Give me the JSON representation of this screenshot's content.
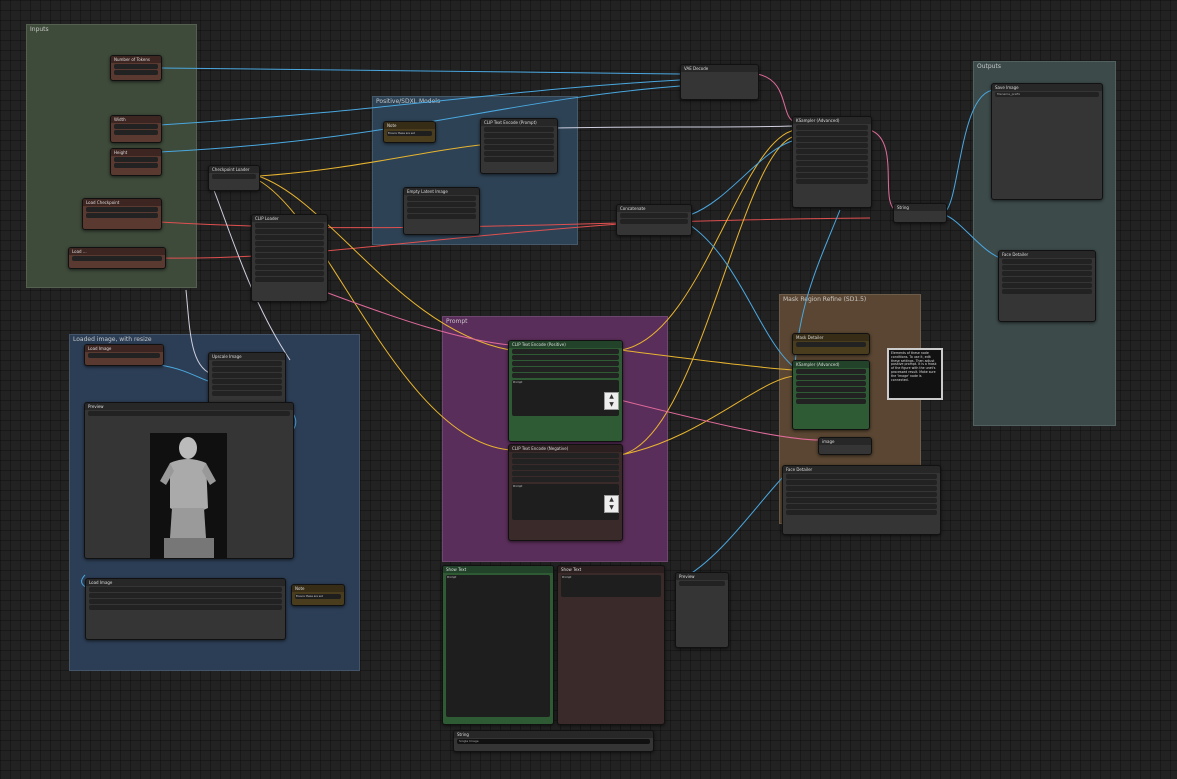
{
  "groups": {
    "inputs": "Inputs",
    "outputs": "Outputs",
    "sdxl_core": "Positive/SDXL Models",
    "prompt": "Prompt",
    "image": "Loaded image, with resize",
    "mask_refiner": "Mask Region Refine (SD1.5)"
  },
  "nodes": {
    "seed": "Number of Tokens",
    "width": "Width",
    "height": "Height",
    "search_prompt": "Load Checkpoint",
    "load_ckpt": "Load ...",
    "checkpoint_loader": "Checkpoint Loader",
    "clip": "CLIP Loader",
    "empty_latent": "Empty Latent Image",
    "note1": "Note",
    "note1_text": "Ensure these are set",
    "clip_encoder": "CLIP Text Encode (Prompt)",
    "vae_decode": "VAE Decode",
    "ksampler": "KSampler (Advanced)",
    "save_image": "Save Image",
    "image_save_path": "filename_prefix",
    "load_image": "Load Image",
    "upscale": "Upscale Image",
    "positive_encode": "CLIP Text Encode (Positive)",
    "negative_encode": "CLIP Text Encode (Negative)",
    "mask_detail": "Mask Detailer",
    "note_black": "Note",
    "note_black_text": "Elements of these node conditions. To use it, edit these settings. Then adjust positive prompt. It is a mask of the figure with the unet's processed result. Make sure the 'Image' node is connected.",
    "image_detail": "Face Detailer",
    "concat": "Concatenate",
    "show_text_1": "Show Text",
    "show_text_2": "Show Text",
    "string_out": "String",
    "preview": "Preview",
    "preview_caption": "Single Image",
    "prompt_text": "Prompt",
    "image_label": "image"
  },
  "colors": {
    "wire_blue": "#4aa8e0",
    "wire_yellow": "#e8b430",
    "wire_pink": "#e06a9a",
    "wire_white": "#d0d0e0",
    "wire_red": "#e05050"
  }
}
